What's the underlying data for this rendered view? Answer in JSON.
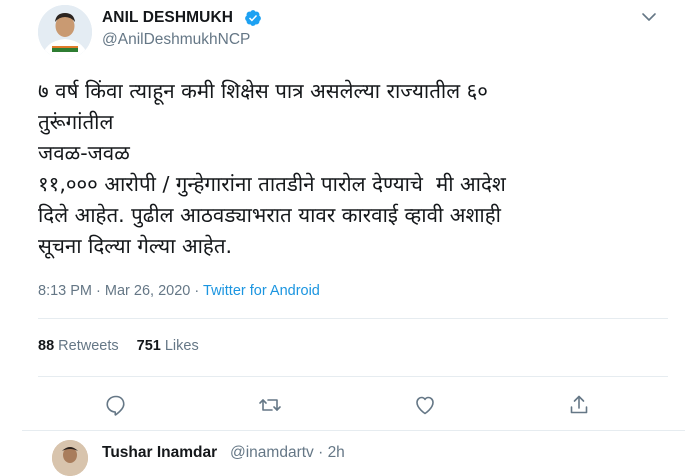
{
  "tweet": {
    "author": {
      "name": "ANIL DESHMUKH",
      "handle": "@AnilDeshmukhNCP",
      "verified": true
    },
    "text_lines": [
      "७ वर्ष किंवा त्याहून कमी शिक्षेस पात्र असलेल्या राज्यातील ६०",
      "तुरूंगांतील",
      "जवळ-जवळ",
      "११,००० आरोपी / गुन्हेगारांना तातडीने पारोल देण्याचे  मी आदेश",
      "दिले आहेत. पुढील आठवड्याभरात यावर कारवाई व्हावी अशाही",
      "सूचना दिल्या गेल्या आहेत."
    ],
    "time": "8:13 PM",
    "separator": "·",
    "date": "Mar 26, 2020",
    "source": "Twitter for Android",
    "retweets_count": "88",
    "retweets_label": "Retweets",
    "likes_count": "751",
    "likes_label": "Likes",
    "actions": [
      "reply-icon",
      "retweet-icon",
      "like-icon",
      "share-icon"
    ],
    "colors": {
      "verified": "#1da1f2",
      "link": "#1b95e0",
      "muted": "#657786"
    }
  },
  "next_reply": {
    "name": "Tushar Inamdar",
    "handle": "@inamdartv · 2h"
  }
}
